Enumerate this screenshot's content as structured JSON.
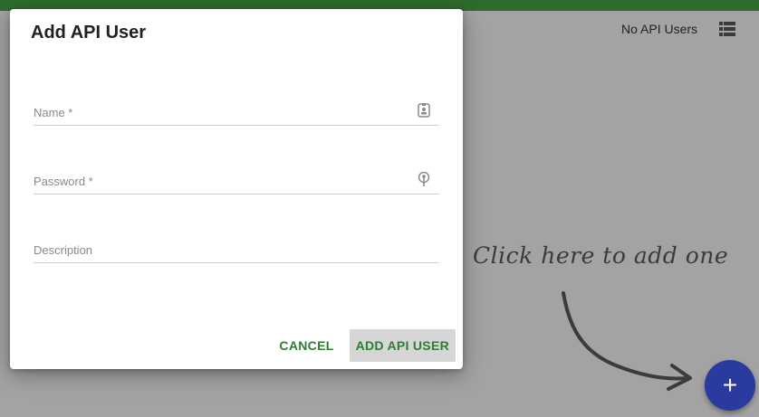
{
  "background": {
    "status_text": "No API Users",
    "list_view_icon": "list-icon",
    "hint_text": "Click here to add one",
    "fab_icon": "plus-icon",
    "fab_label": "+",
    "fab_color": "#2b3a9e"
  },
  "dialog": {
    "title": "Add API User",
    "fields": [
      {
        "placeholder": "Name *",
        "value": "",
        "icon": "id-badge-icon"
      },
      {
        "placeholder": "Password *",
        "value": "",
        "icon": "key-icon"
      },
      {
        "placeholder": "Description",
        "value": ""
      }
    ],
    "cancel_label": "CANCEL",
    "submit_label": "ADD API USER"
  },
  "colors": {
    "topbar": "#2e6b2e",
    "accent_text": "#2e7d32"
  }
}
